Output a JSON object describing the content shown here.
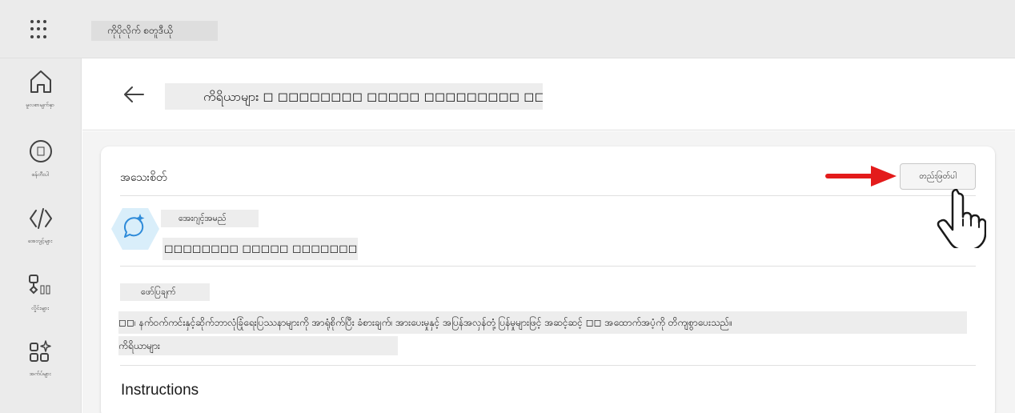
{
  "topbar": {
    "app_title": "ကိုပိုလိုက် စတူဒီယို"
  },
  "rail": {
    "items": [
      {
        "label": "မူလစာမျက်နှာ",
        "icon": "home-icon"
      },
      {
        "label": "ဖန်တီးပါ",
        "icon": "create-icon"
      },
      {
        "label": "အေးဂျင့်များ",
        "icon": "code-icon"
      },
      {
        "label": "လှိုင်းများ",
        "icon": "flow-icon"
      },
      {
        "label": "အက်ပ်များ",
        "icon": "apps-icon"
      }
    ]
  },
  "header": {
    "page_title": "ကိရိယာများ ◻ ◻◻◻◻◻◻◻◻ ◻◻◻◻◻ ◻◻◻◻◻◻◻◻◻ ◻◻◻"
  },
  "details": {
    "section_title": "အသေးစိတ်",
    "edit_label": "တည်းဖြတ်ပါ",
    "greeting_label": "အေးဂျင့်အမည်",
    "agent_name": "◻◻◻◻◻◻◻◻ ◻◻◻◻◻ ◻◻◻◻◻◻◻◻◻ ◻◻◻",
    "description_label": "ဖော်ပြချက်",
    "description_line1": "◻◻၊ နက်ဝက်ကင်းနှင့်ဆိုက်ဘာလုံခြုံရေးပြဿနာများကို အာရုံစိုက်ပြီး ခံစားချက်၊ အားပေးမှုနှင့် အပြန်အလှန်တုံ့ပြန်မှုများဖြင့် အဆင့်ဆင့် ◻◻ အထောက်အပံ့ကို တိကျစွာပေးသည်။",
    "description_line2": "ကိရိယာများ",
    "instructions_title": "Instructions"
  },
  "colors": {
    "accent_red": "#e31b1b",
    "hex_badge": "#d9eefa",
    "hex_icon": "#2e8bd9"
  }
}
